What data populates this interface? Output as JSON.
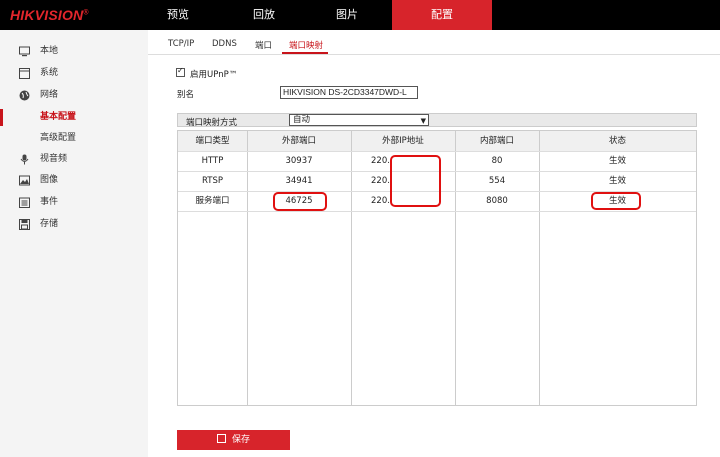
{
  "header": {
    "logo": "HIKVISION",
    "logo_mark": "®",
    "nav": [
      "预览",
      "回放",
      "图片",
      "配置"
    ],
    "active_nav": "配置"
  },
  "sidebar": {
    "items": [
      {
        "label": "本地",
        "icon": "monitor-icon"
      },
      {
        "label": "系统",
        "icon": "system-icon"
      },
      {
        "label": "网络",
        "icon": "globe-icon"
      },
      {
        "label": "基本配置",
        "icon": ""
      },
      {
        "label": "高级配置",
        "icon": ""
      },
      {
        "label": "视音频",
        "icon": "microphone-icon"
      },
      {
        "label": "图像",
        "icon": "image-icon"
      },
      {
        "label": "事件",
        "icon": "calendar-icon"
      },
      {
        "label": "存储",
        "icon": "storage-icon"
      }
    ],
    "active": "基本配置"
  },
  "tabs": [
    "TCP/IP",
    "DDNS",
    "端口",
    "端口映射"
  ],
  "active_tab": "端口映射",
  "upnp": {
    "label": "启用UPnP™",
    "checked": true
  },
  "alias": {
    "label": "别名",
    "value": "HIKVISION DS-2CD3347DWD-L"
  },
  "mapping_mode": {
    "label": "端口映射方式",
    "value": "自动"
  },
  "table": {
    "headers": [
      "端口类型",
      "外部端口",
      "外部IP地址",
      "内部端口",
      "状态"
    ],
    "rows": [
      [
        "HTTP",
        "30937",
        "220.",
        "80",
        "生效"
      ],
      [
        "RTSP",
        "34941",
        "220.",
        "554",
        "生效"
      ],
      [
        "服务端口",
        "46725",
        "220.",
        "8080",
        "生效"
      ]
    ]
  },
  "save_label": "保存",
  "colors": {
    "accent": "#d7242b",
    "highlight": "#e01010"
  }
}
